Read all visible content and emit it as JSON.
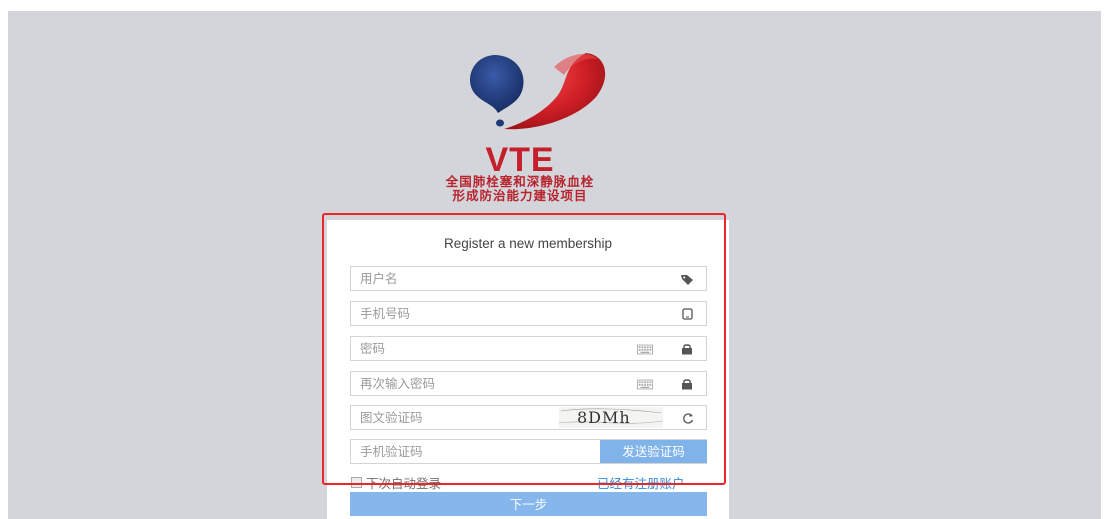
{
  "header": {
    "brand": "VTE",
    "subtitle_line1": "全国肺栓塞和深静脉血栓",
    "subtitle_line2": "形成防治能力建设项目"
  },
  "form": {
    "title": "Register a new membership",
    "username_placeholder": "用户名",
    "phone_placeholder": "手机号码",
    "password_placeholder": "密码",
    "confirm_password_placeholder": "再次输入密码",
    "captcha_placeholder": "图文验证码",
    "captcha_text": "8DMh",
    "sms_code_placeholder": "手机验证码",
    "send_code_label": "发送验证码",
    "remember_label": "下次自动登录",
    "login_link": "已经有注册账户",
    "next_label": "下一步"
  },
  "icons": {
    "username": "tag-icon",
    "phone": "mobile-icon",
    "password_keyboard": "keyboard-icon",
    "password_lock": "lock-icon",
    "captcha_refresh": "refresh-icon"
  },
  "colors": {
    "brand_red": "#c41f2b",
    "brand_blue": "#1f3a78",
    "accent_button": "#85b6ec",
    "link": "#2d8ad6",
    "highlight": "#e8262b",
    "background": "#d3d5da"
  }
}
